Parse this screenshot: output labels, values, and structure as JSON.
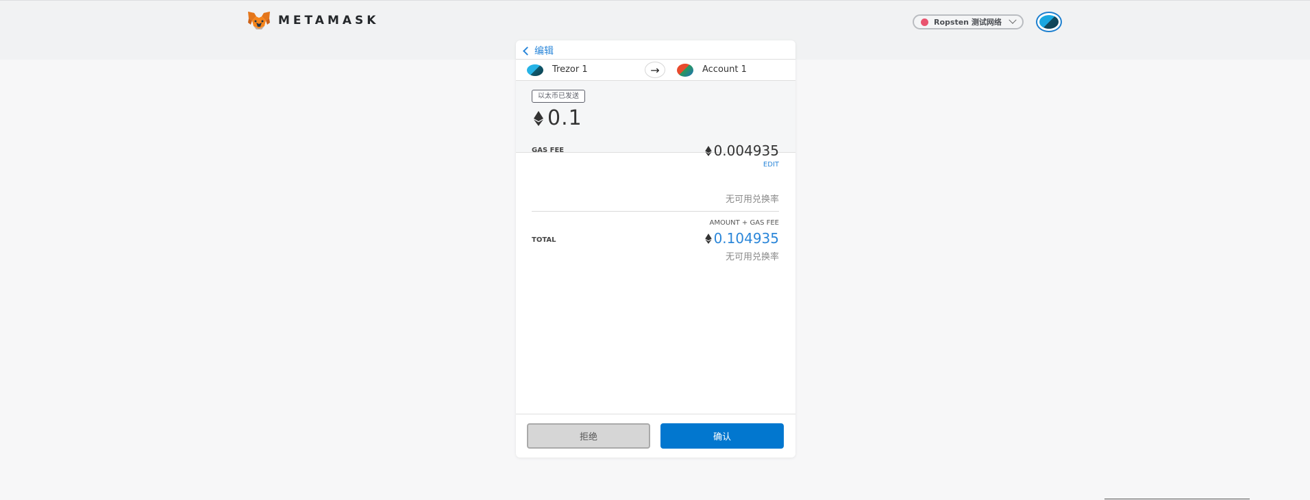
{
  "header": {
    "brand": "METAMASK",
    "network": {
      "label": "Ropsten 测试网络",
      "dot_color": "#e9536e"
    }
  },
  "confirm": {
    "back_label": "编辑",
    "from": {
      "name": "Trezor 1"
    },
    "to": {
      "name": "Account 1"
    },
    "tx_type": "以太币已发送",
    "amount": "0.1",
    "gas": {
      "label": "GAS FEE",
      "edit_label": "EDIT",
      "value": "0.004935",
      "fiat": "无可用兑换率"
    },
    "total": {
      "label": "TOTAL",
      "sub_label": "AMOUNT + GAS FEE",
      "value": "0.104935",
      "fiat": "无可用兑换率"
    },
    "buttons": {
      "reject": "拒绝",
      "confirm": "确认"
    }
  },
  "colors": {
    "accent": "#2a86d9",
    "confirm_button": "#0277cf",
    "reject_button": "#d6d6d6"
  },
  "icons": [
    "metamask-fox-icon",
    "chevron-down-icon",
    "chevron-left-icon",
    "arrow-right-icon",
    "eth-icon"
  ]
}
